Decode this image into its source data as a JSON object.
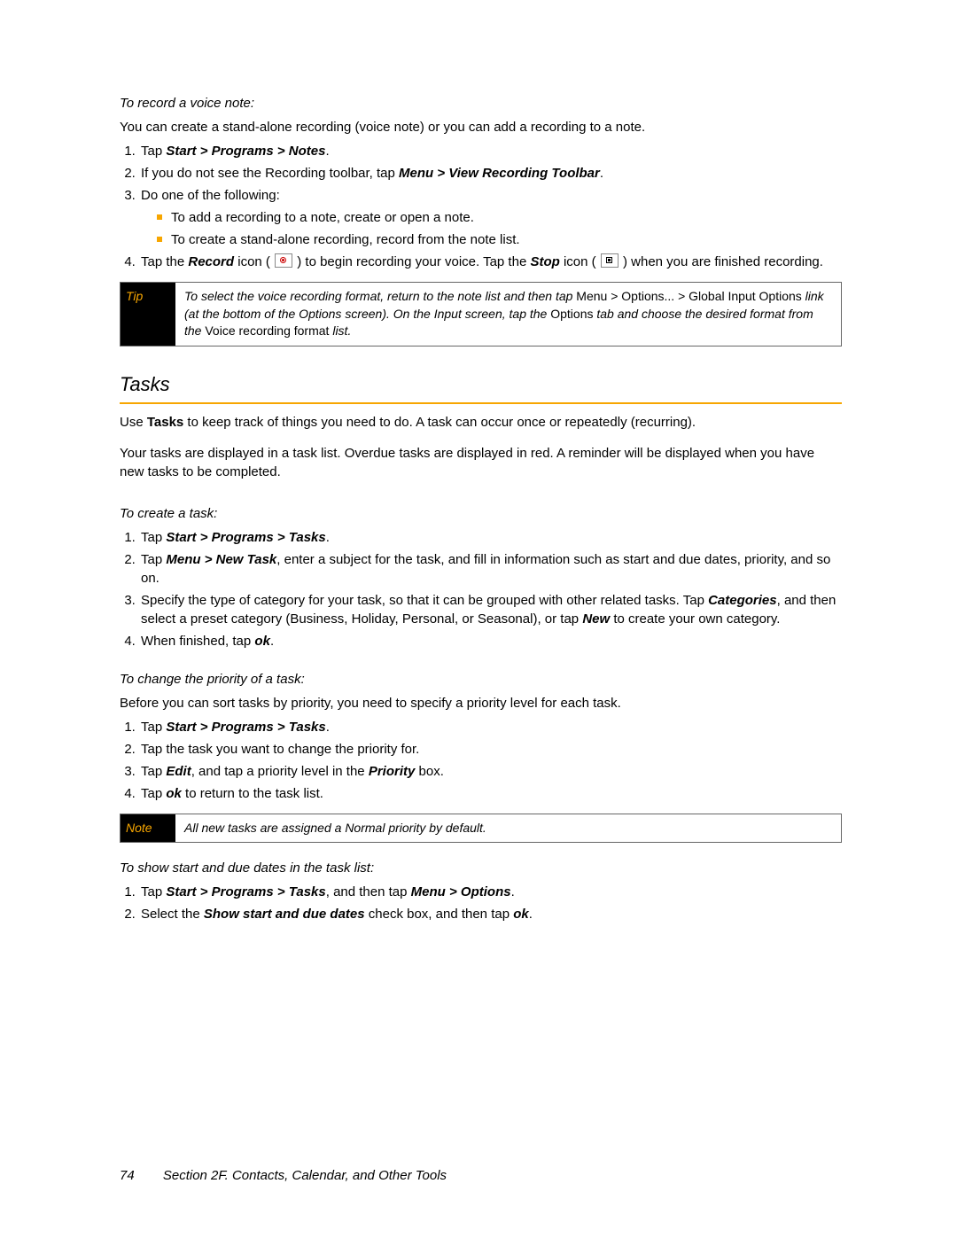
{
  "voice": {
    "heading": "To record a voice note:",
    "intro": "You can create a stand-alone recording (voice note) or you can add a recording to a note.",
    "step1_pre": "Tap ",
    "step1_path": "Start > Programs > Notes",
    "step2_pre": "If you do not see the Recording toolbar, tap ",
    "step2_path": "Menu > View Recording Toolbar",
    "step3": "Do one of the following:",
    "step3a": "To add a recording to a note, create or open a note.",
    "step3b": "To create a stand-alone recording, record from the note list.",
    "step4_pre": "Tap the ",
    "record_word": "Record",
    "step4_mid1": " icon ( ",
    "step4_mid2": " ) to begin recording your voice. Tap the ",
    "stop_word": "Stop",
    "step4_mid3": " icon ( ",
    "step4_end": " ) when you are finished recording."
  },
  "tip": {
    "label": "Tip",
    "t1": "To select the voice recording format, return to the note list and then tap ",
    "p1": "Menu > Options... > Global Input Options",
    "t2": " link (at the bottom of the Options screen). On the Input screen, tap the ",
    "p2": "Options",
    "t3": " tab and choose the desired format from the ",
    "p3": "Voice recording format",
    "t4": " list."
  },
  "tasks": {
    "title": "Tasks",
    "para1_pre": "Use ",
    "para1_word": "Tasks",
    "para1_post": " to keep track of things you need to do. A task can occur once or repeatedly (recurring).",
    "para2": "Your tasks are displayed in a task list. Overdue tasks are displayed in red. A reminder will be displayed when you have new tasks to be completed."
  },
  "create": {
    "heading": "To create a task:",
    "s1_pre": "Tap ",
    "s1_path": "Start > Programs > Tasks",
    "s2_pre": "Tap ",
    "s2_path": "Menu > New Task",
    "s2_post": ", enter a subject for the task, and fill in information such as start and due dates, priority, and so on.",
    "s3_pre": "Specify the type of category for your task, so that it can be grouped with other related tasks. Tap ",
    "s3_word1": "Categories",
    "s3_mid": ", and then select a preset category (Business, Holiday, Personal, or Seasonal), or tap ",
    "s3_word2": "New",
    "s3_post": " to create your own category.",
    "s4_pre": "When finished, tap ",
    "s4_word": "ok"
  },
  "priority": {
    "heading": "To change the priority of a task:",
    "intro": "Before you can sort tasks by priority, you need to specify a priority level for each task.",
    "s1_pre": "Tap ",
    "s1_path": "Start > Programs > Tasks",
    "s2": "Tap the task you want to change the priority for.",
    "s3_pre": "Tap ",
    "s3_word1": "Edit",
    "s3_mid": ", and tap a priority level in the ",
    "s3_word2": "Priority",
    "s3_post": " box.",
    "s4_pre": "Tap ",
    "s4_word": "ok",
    "s4_post": " to return to the task list."
  },
  "note": {
    "label": "Note",
    "text": "All new tasks are assigned a Normal priority by default."
  },
  "dates": {
    "heading": "To show start and due dates in the task list:",
    "s1_pre": "Tap ",
    "s1_path1": "Start > Programs > Tasks",
    "s1_mid": ", and then tap ",
    "s1_path2": "Menu > Options",
    "s2_pre": "Select the ",
    "s2_word": "Show start and due dates",
    "s2_mid": " check box, and then tap ",
    "s2_word2": "ok"
  },
  "footer": {
    "page": "74",
    "section": "Section 2F. Contacts, Calendar, and Other Tools"
  }
}
